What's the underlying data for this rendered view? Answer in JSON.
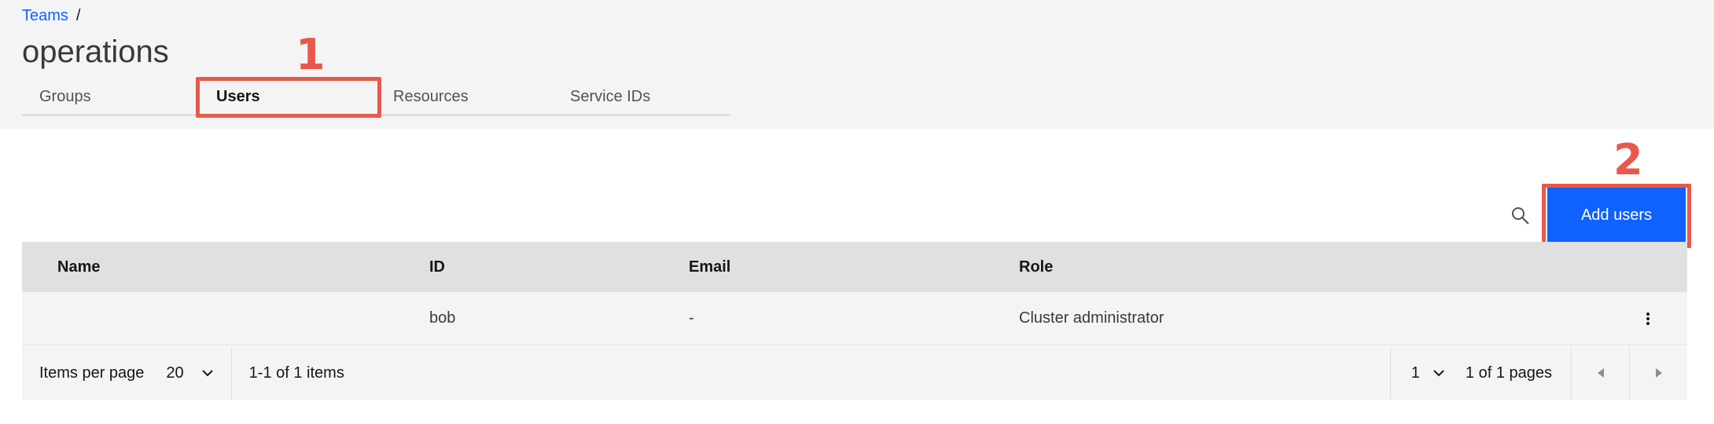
{
  "breadcrumb": {
    "parent": "Teams",
    "separator": "/"
  },
  "page_title": "operations",
  "tabs": [
    {
      "label": "Groups"
    },
    {
      "label": "Users"
    },
    {
      "label": "Resources"
    },
    {
      "label": "Service IDs"
    }
  ],
  "active_tab": "Users",
  "annotations": [
    {
      "label": "1"
    },
    {
      "label": "2"
    }
  ],
  "toolbar": {
    "search_icon": "search-icon",
    "add_label": "Add users"
  },
  "table": {
    "columns": [
      "Name",
      "ID",
      "Email",
      "Role"
    ],
    "rows": [
      {
        "name": "",
        "id": "bob",
        "email": "-",
        "role": "Cluster administrator"
      }
    ]
  },
  "pagination": {
    "items_per_page_label": "Items per page",
    "items_per_page": "20",
    "range_text": "1-1 of 1 items",
    "page": "1",
    "pages_text": "1 of 1 pages"
  },
  "colors": {
    "accent": "#0f62fe",
    "annotation": "#e9594b"
  }
}
